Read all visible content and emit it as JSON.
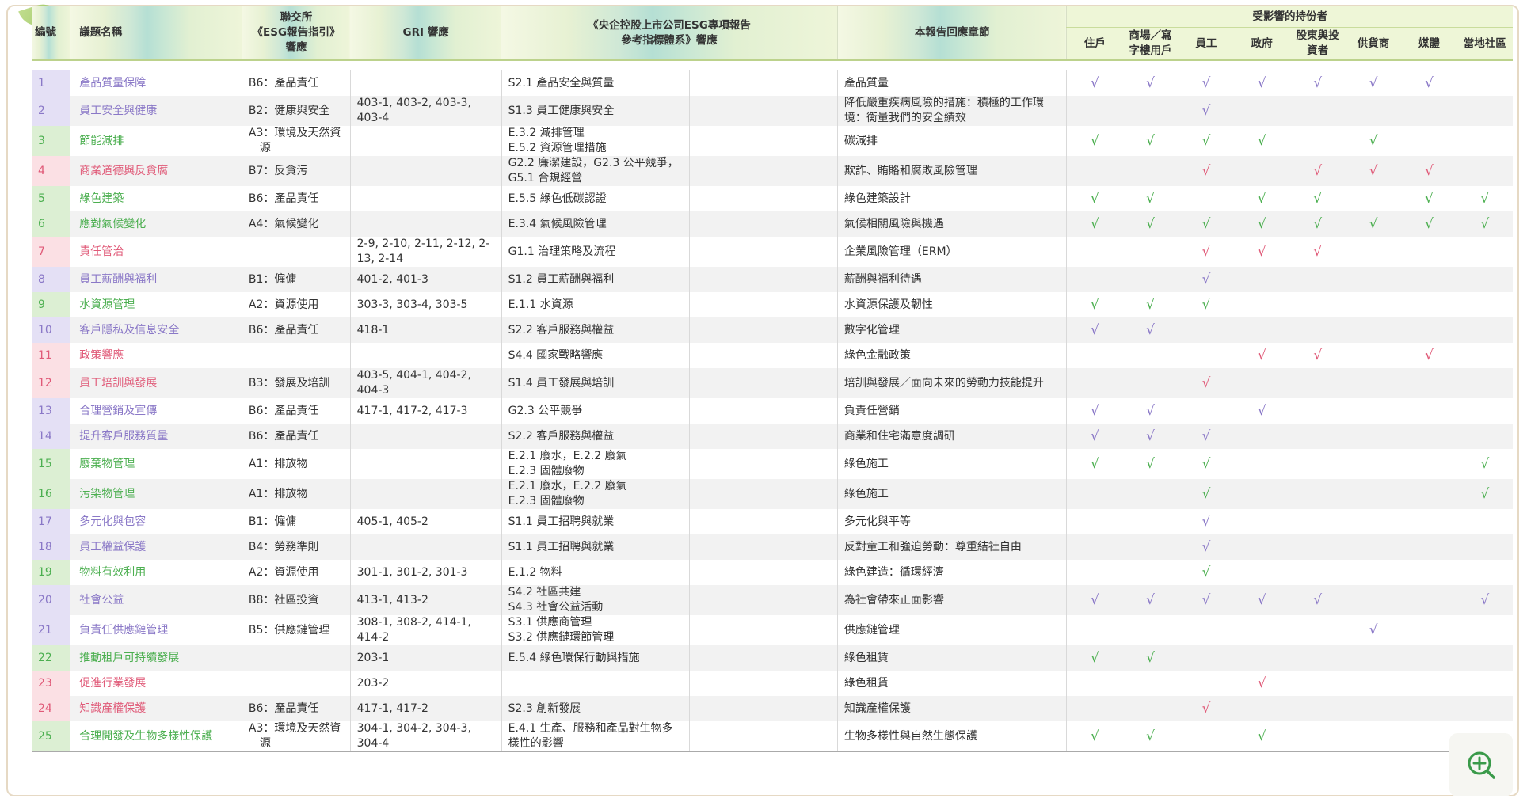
{
  "headers": {
    "num": "編號",
    "topic": "議題名稱",
    "hkex": "聯交所\n《ESG報告指引》\n響應",
    "gri": "GRI 響應",
    "sasac": "《央企控股上市公司ESG專項報告\n參考指標體系》響應",
    "chapter": "本報告回應章節",
    "stakeholders_title": "受影響的持份者",
    "stakeholders": [
      "住戶",
      "商場／寫字樓用戶",
      "員工",
      "政府",
      "股東與投資者",
      "供貨商",
      "媒體",
      "當地社區"
    ]
  },
  "rows": [
    {
      "num": "1",
      "topic": "產品質量保障",
      "color": "purple",
      "hkex": "B6：產品責任",
      "gri": "",
      "sasac": "S2.1 產品安全與質量",
      "chapter": "產品質量",
      "checks": [
        1,
        1,
        1,
        1,
        1,
        1,
        1,
        0
      ]
    },
    {
      "num": "2",
      "topic": "員工安全與健康",
      "color": "purple",
      "hkex": "B2：健康與安全",
      "gri": "403-1, 403-2, 403-3, 403-4",
      "sasac": "S1.3 員工健康與安全",
      "chapter": "降低嚴重疾病風險的措施：積極的工作環境：衡量我們的安全績效",
      "checks": [
        0,
        0,
        1,
        0,
        0,
        0,
        0,
        0
      ]
    },
    {
      "num": "3",
      "topic": "節能減排",
      "color": "green",
      "hkex": "A3：環境及天然資源",
      "gri": "",
      "sasac": "E.3.2 減排管理\nE.5.2 資源管理措施",
      "chapter": "碳減排",
      "checks": [
        1,
        1,
        1,
        1,
        0,
        1,
        0,
        0
      ]
    },
    {
      "num": "4",
      "topic": "商業道德與反貪腐",
      "color": "red",
      "hkex": "B7：反貪污",
      "gri": "",
      "sasac": "G2.2 廉潔建設，G2.3 公平競爭，G5.1 合規經營",
      "chapter": "欺詐、賄賂和腐敗風險管理",
      "checks": [
        0,
        0,
        1,
        0,
        1,
        1,
        1,
        0
      ]
    },
    {
      "num": "5",
      "topic": "綠色建築",
      "color": "green",
      "hkex": "B6：產品責任",
      "gri": "",
      "sasac": "E.5.5 綠色低碳認證",
      "chapter": "綠色建築設計",
      "checks": [
        1,
        1,
        0,
        1,
        1,
        0,
        1,
        1
      ]
    },
    {
      "num": "6",
      "topic": "應對氣候變化",
      "color": "green",
      "hkex": "A4：氣候變化",
      "gri": "",
      "sasac": "E.3.4 氣候風險管理",
      "chapter": "氣候相關風險與機遇",
      "checks": [
        1,
        1,
        1,
        1,
        1,
        1,
        1,
        1
      ]
    },
    {
      "num": "7",
      "topic": "責任管治",
      "color": "red",
      "hkex": "",
      "gri": "2-9, 2-10, 2-11, 2-12, 2-13, 2-14",
      "sasac": "G1.1 治理策略及流程",
      "chapter": "企業風險管理（ERM）",
      "checks": [
        0,
        0,
        1,
        1,
        1,
        0,
        0,
        0
      ]
    },
    {
      "num": "8",
      "topic": "員工薪酬與福利",
      "color": "purple",
      "hkex": "B1：僱傭",
      "gri": "401-2, 401-3",
      "sasac": "S1.2 員工薪酬與福利",
      "chapter": "薪酬與福利待遇",
      "checks": [
        0,
        0,
        1,
        0,
        0,
        0,
        0,
        0
      ]
    },
    {
      "num": "9",
      "topic": "水資源管理",
      "color": "green",
      "hkex": "A2：資源使用",
      "gri": "303-3, 303-4, 303-5",
      "sasac": "E.1.1 水資源",
      "chapter": "水資源保護及韌性",
      "checks": [
        1,
        1,
        1,
        0,
        0,
        0,
        0,
        0
      ]
    },
    {
      "num": "10",
      "topic": "客戶隱私及信息安全",
      "color": "purple",
      "hkex": "B6：產品責任",
      "gri": "418-1",
      "sasac": "S2.2 客戶服務與權益",
      "chapter": "數字化管理",
      "checks": [
        1,
        1,
        0,
        0,
        0,
        0,
        0,
        0
      ]
    },
    {
      "num": "11",
      "topic": "政策響應",
      "color": "red",
      "hkex": "",
      "gri": "",
      "sasac": "S4.4 國家戰略響應",
      "chapter": "綠色金融政策",
      "checks": [
        0,
        0,
        0,
        1,
        1,
        0,
        1,
        0
      ]
    },
    {
      "num": "12",
      "topic": "員工培訓與發展",
      "color": "red",
      "hkex": "B3：發展及培訓",
      "gri": "403-5, 404-1, 404-2, 404-3",
      "sasac": "S1.4 員工發展與培訓",
      "chapter": "培訓與發展／面向未來的勞動力技能提升",
      "checks": [
        0,
        0,
        1,
        0,
        0,
        0,
        0,
        0
      ]
    },
    {
      "num": "13",
      "topic": "合理營銷及宣傳",
      "color": "purple",
      "hkex": "B6：產品責任",
      "gri": "417-1, 417-2, 417-3",
      "sasac": "G2.3 公平競爭",
      "chapter": "負責任營銷",
      "checks": [
        1,
        1,
        0,
        1,
        0,
        0,
        0,
        0
      ]
    },
    {
      "num": "14",
      "topic": "提升客戶服務質量",
      "color": "purple",
      "hkex": "B6：產品責任",
      "gri": "",
      "sasac": "S2.2 客戶服務與權益",
      "chapter": "商業和住宅滿意度調研",
      "checks": [
        1,
        1,
        1,
        0,
        0,
        0,
        0,
        0
      ]
    },
    {
      "num": "15",
      "topic": "廢棄物管理",
      "color": "green",
      "hkex": "A1：排放物",
      "gri": "",
      "sasac": "E.2.1 廢水，E.2.2 廢氣\nE.2.3 固體廢物",
      "chapter": "綠色施工",
      "checks": [
        1,
        1,
        1,
        0,
        0,
        0,
        0,
        1
      ]
    },
    {
      "num": "16",
      "topic": "污染物管理",
      "color": "green",
      "hkex": "A1：排放物",
      "gri": "",
      "sasac": "E.2.1 廢水，E.2.2 廢氣\nE.2.3 固體廢物",
      "chapter": "綠色施工",
      "checks": [
        0,
        0,
        1,
        0,
        0,
        0,
        0,
        1
      ]
    },
    {
      "num": "17",
      "topic": "多元化與包容",
      "color": "purple",
      "hkex": "B1：僱傭",
      "gri": "405-1, 405-2",
      "sasac": "S1.1 員工招聘與就業",
      "chapter": "多元化與平等",
      "checks": [
        0,
        0,
        1,
        0,
        0,
        0,
        0,
        0
      ]
    },
    {
      "num": "18",
      "topic": "員工權益保護",
      "color": "purple",
      "hkex": "B4：勞務準則",
      "gri": "",
      "sasac": "S1.1 員工招聘與就業",
      "chapter": "反對童工和強迫勞動：尊重結社自由",
      "checks": [
        0,
        0,
        1,
        0,
        0,
        0,
        0,
        0
      ]
    },
    {
      "num": "19",
      "topic": "物料有效利用",
      "color": "green",
      "hkex": "A2：資源使用",
      "gri": "301-1, 301-2, 301-3",
      "sasac": "E.1.2 物料",
      "chapter": "綠色建造：循環經濟",
      "checks": [
        0,
        0,
        1,
        0,
        0,
        0,
        0,
        0
      ]
    },
    {
      "num": "20",
      "topic": "社會公益",
      "color": "purple",
      "hkex": "B8：社區投資",
      "gri": "413-1, 413-2",
      "sasac": "S4.2 社區共建\nS4.3 社會公益活動",
      "chapter": "為社會帶來正面影響",
      "checks": [
        1,
        1,
        1,
        1,
        1,
        0,
        0,
        1
      ]
    },
    {
      "num": "21",
      "topic": "負責任供應鏈管理",
      "color": "purple",
      "hkex": "B5：供應鏈管理",
      "gri": "308-1, 308-2, 414-1, 414-2",
      "sasac": "S3.1 供應商管理\nS3.2 供應鏈環節管理",
      "chapter": "供應鏈管理",
      "checks": [
        0,
        0,
        0,
        0,
        0,
        1,
        0,
        0
      ]
    },
    {
      "num": "22",
      "topic": "推動租戶可持續發展",
      "color": "green",
      "hkex": "",
      "gri": "203-1",
      "sasac": "E.5.4 綠色環保行動與措施",
      "chapter": "綠色租賃",
      "checks": [
        1,
        1,
        0,
        0,
        0,
        0,
        0,
        0
      ]
    },
    {
      "num": "23",
      "topic": "促進行業發展",
      "color": "red",
      "hkex": "",
      "gri": "203-2",
      "sasac": "",
      "chapter": "綠色租賃",
      "checks": [
        0,
        0,
        0,
        1,
        0,
        0,
        0,
        0
      ]
    },
    {
      "num": "24",
      "topic": "知識產權保護",
      "color": "red",
      "hkex": "B6：產品責任",
      "gri": "417-1, 417-2",
      "sasac": "S2.3 創新發展",
      "chapter": "知識產權保護",
      "checks": [
        0,
        0,
        1,
        0,
        0,
        0,
        0,
        0
      ]
    },
    {
      "num": "25",
      "topic": "合理開發及生物多樣性保護",
      "color": "green",
      "hkex": "A3：環境及天然資源",
      "gri": "304-1, 304-2, 304-3, 304-4",
      "sasac": "E.4.1 生產、服務和產品對生物多樣性的影響",
      "chapter": "生物多樣性與自然生態保護",
      "checks": [
        1,
        1,
        0,
        1,
        0,
        0,
        0,
        0
      ]
    }
  ],
  "check_mark": "√",
  "colors": {
    "purple": "#8a78c7",
    "green": "#4caf50",
    "red": "#e05a78"
  },
  "zoom_icon": "zoom-in-icon"
}
